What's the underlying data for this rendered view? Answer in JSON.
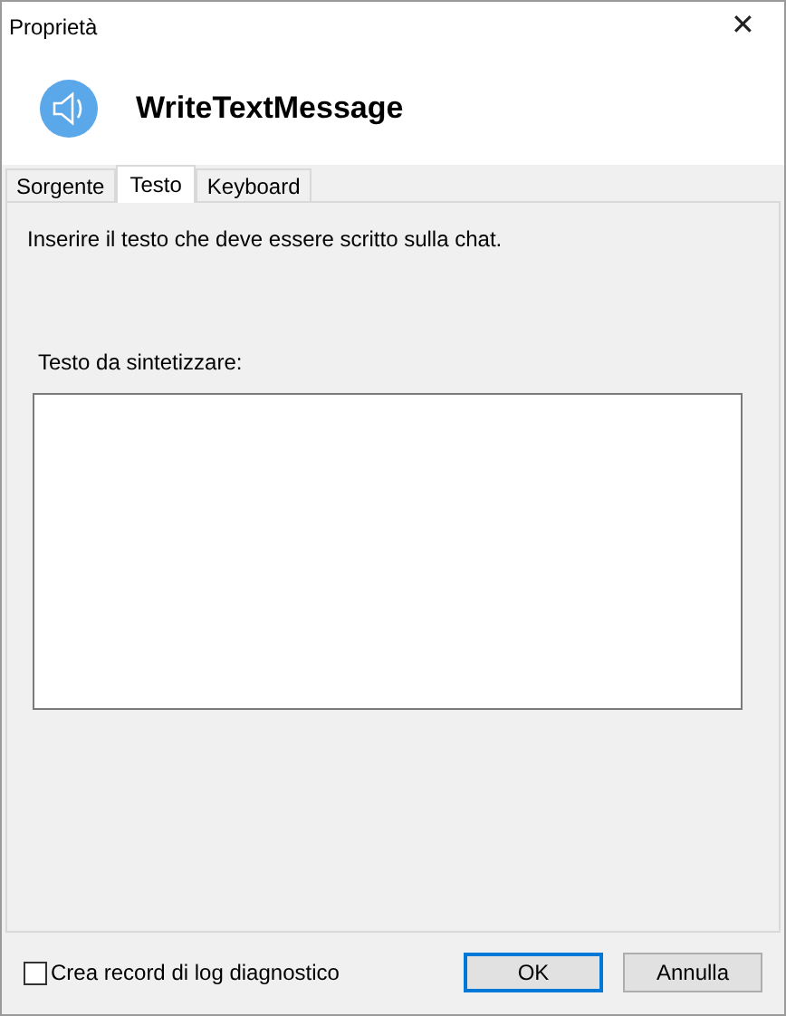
{
  "window": {
    "title": "Proprietà",
    "close": "✕"
  },
  "header": {
    "title": "WriteTextMessage"
  },
  "tabs": [
    {
      "label": "Sorgente",
      "selected": false
    },
    {
      "label": "Testo",
      "selected": true
    },
    {
      "label": "Keyboard",
      "selected": false
    }
  ],
  "panel": {
    "instruction": "Inserire il testo che deve essere scritto sulla chat.",
    "field_label": "Testo da sintetizzare:"
  },
  "footer": {
    "checkbox": {
      "label": "Crea record di log diagnostico",
      "checked": false
    },
    "buttons": [
      {
        "label": "OK",
        "default": true
      },
      {
        "label": "Annulla",
        "default": false
      }
    ]
  }
}
